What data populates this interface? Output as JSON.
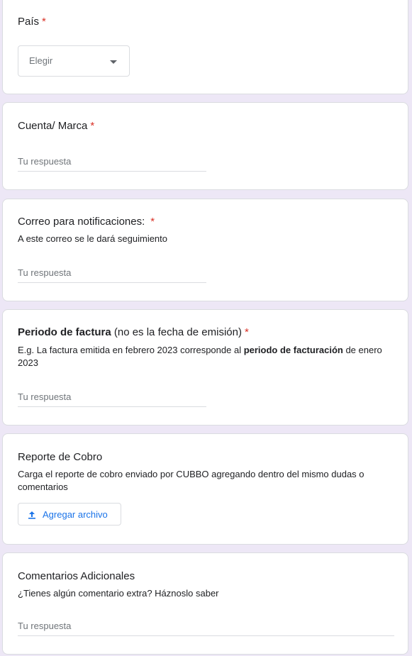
{
  "questions": {
    "pais": {
      "title": "País",
      "required_mark": "*",
      "dropdown_value": "Elegir"
    },
    "cuenta": {
      "title": "Cuenta/ Marca",
      "required_mark": "*",
      "placeholder": "Tu respuesta"
    },
    "correo": {
      "title": "Correo para notificaciones:",
      "required_mark": "*",
      "description": "A este correo se le dará seguimiento",
      "placeholder": "Tu respuesta"
    },
    "periodo": {
      "title_bold": "Periodo de factura",
      "title_rest": " (no es la fecha de emisión)",
      "required_mark": "*",
      "description_start": "E.g. La factura emitida en febrero 2023 corresponde al ",
      "description_bold": "periodo de facturación",
      "description_end": " de enero 2023",
      "placeholder": "Tu respuesta"
    },
    "reporte": {
      "title": "Reporte de Cobro",
      "description": "Carga el reporte de cobro enviado por CUBBO agregando dentro del mismo dudas o comentarios",
      "upload_label": "Agregar archivo",
      "upload_icon": "upload-icon"
    },
    "comentarios": {
      "title": "Comentarios Adicionales",
      "description": "¿Tienes algún comentario extra? Háznoslo saber",
      "placeholder": "Tu respuesta"
    }
  },
  "colors": {
    "background": "#ede7f6",
    "required": "#d93025",
    "accent": "#1a73e8"
  }
}
